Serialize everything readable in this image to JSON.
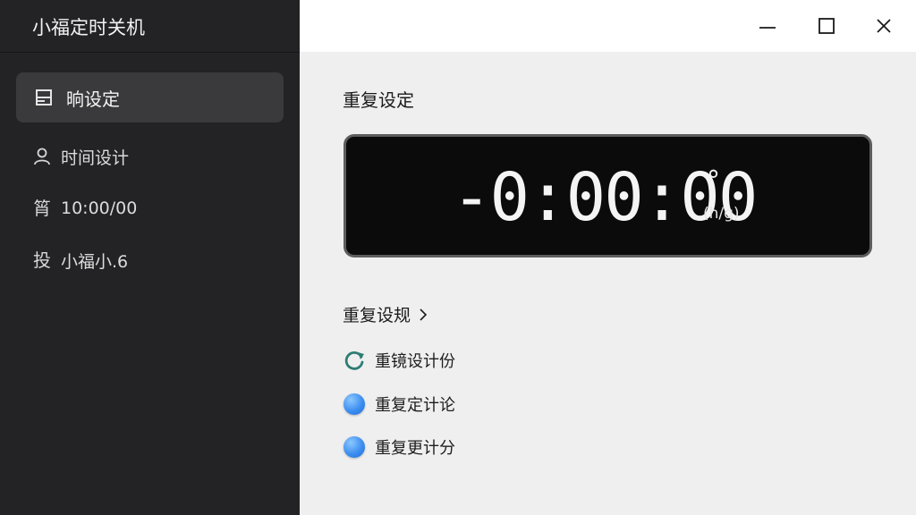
{
  "app": {
    "title": "小福定时关机"
  },
  "sidebar": {
    "items": [
      {
        "label": "晌设定",
        "icon": "calendar-icon",
        "active": true
      },
      {
        "label": "时间设计",
        "icon": "user-icon",
        "active": false
      },
      {
        "label": "10:00/00",
        "icon": "tube-glyph-icon",
        "glyph": "筲",
        "active": false
      },
      {
        "label": "小福小.6",
        "icon": "hand-glyph-icon",
        "glyph": "投",
        "active": false
      }
    ]
  },
  "window_controls": {
    "minimize": "minimize-icon",
    "maximize": "maximize-icon",
    "close": "close-icon"
  },
  "main": {
    "section_title": "重复设定",
    "timer": {
      "value": "-0:00:00",
      "degree": "°",
      "unit": "(h/g)"
    },
    "sub_title": "重复设规",
    "options": [
      {
        "label": "重镜设计份",
        "icon": "refresh-icon"
      },
      {
        "label": "重复定计论",
        "icon": "blue-dot-icon"
      },
      {
        "label": "重复更计分",
        "icon": "blue-dot-icon"
      }
    ]
  },
  "colors": {
    "sidebar_bg": "#232325",
    "sidebar_active": "#3a3a3c",
    "main_bg": "#efefef",
    "display_bg": "#0b0b0b",
    "accent_blue": "#3d8ef0",
    "refresh_teal": "#2e7d74"
  }
}
